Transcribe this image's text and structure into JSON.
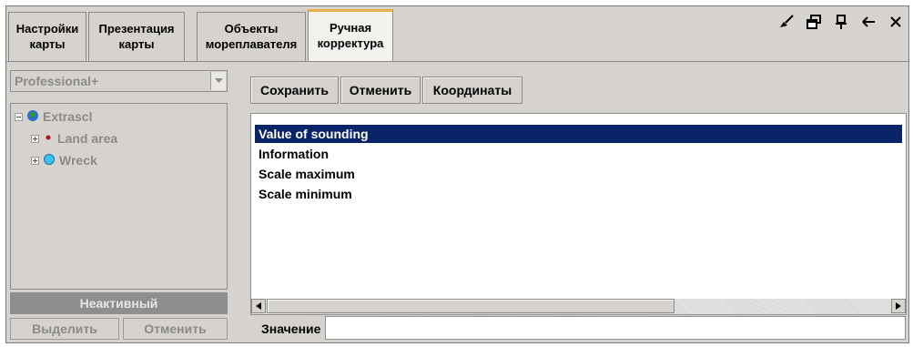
{
  "tabs": [
    {
      "line1": "Настройки",
      "line2": "карты"
    },
    {
      "line1": "Презентация",
      "line2": "карты"
    },
    {
      "line1": "Объекты",
      "line2": "мореплавателя"
    },
    {
      "line1": "Ручная",
      "line2": "корректура"
    }
  ],
  "active_tab": "Ручная корректура",
  "toolbar_icons": [
    "brush-icon",
    "restore-window-icon",
    "pin-icon",
    "back-arrow-icon",
    "close-icon"
  ],
  "left_panel": {
    "combo_value": "Professional+",
    "tree": {
      "root": "Extrascl",
      "children": [
        "Land area",
        "Wreck"
      ]
    },
    "status": "Неактивный",
    "select_label": "Выделить",
    "cancel_label": "Отменить"
  },
  "right_panel": {
    "save_label": "Сохранить",
    "cancel_label": "Отменить",
    "coords_label": "Координаты",
    "attributes": [
      "Value of sounding",
      "Information",
      "Scale maximum",
      "Scale minimum"
    ],
    "selected_attribute": "Value of sounding",
    "value_label": "Значение",
    "value": ""
  },
  "colors": {
    "selection": "#0a246a",
    "active_tab_accent": "#e8b04a",
    "panel_bg": "#d6d3ce"
  }
}
